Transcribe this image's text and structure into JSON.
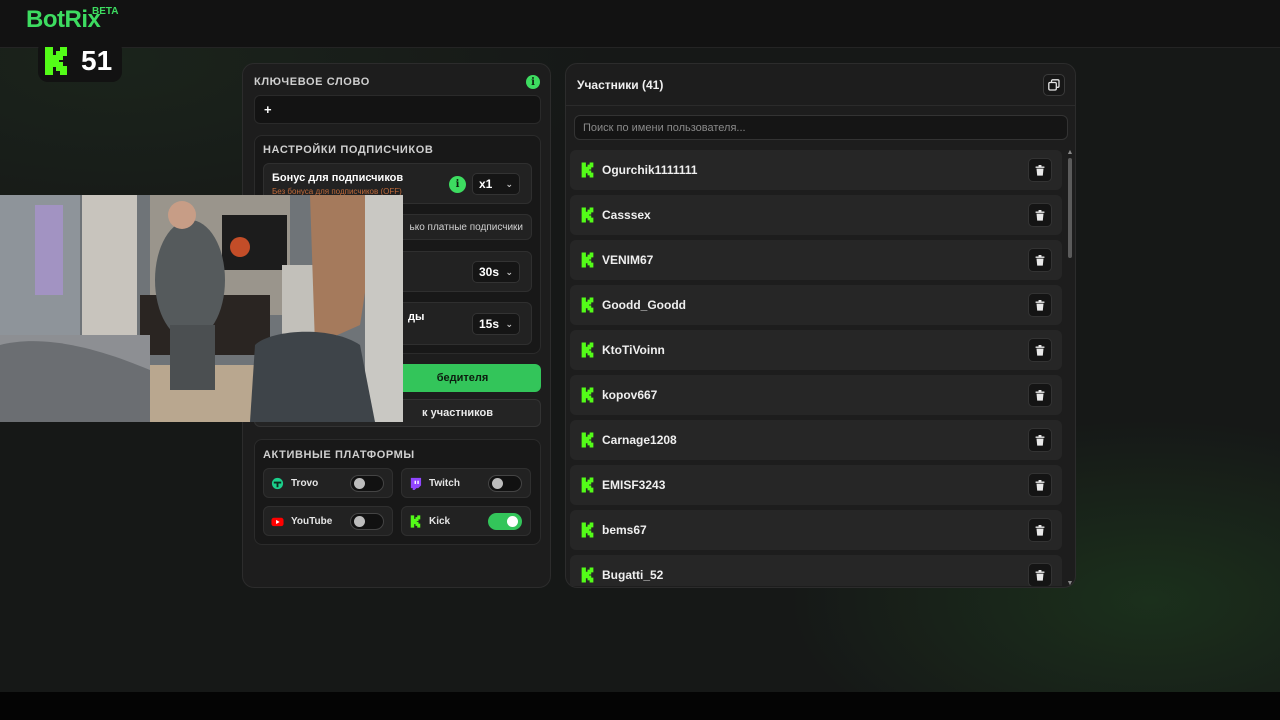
{
  "brand": {
    "name": "BotRix",
    "badge": "BETA"
  },
  "viewer_count": "51",
  "keyword": {
    "label": "КЛЮЧЕВОЕ СЛОВО",
    "value": "+"
  },
  "subscribers": {
    "title": "НАСТРОЙКИ ПОДПИСЧИКОВ",
    "bonus_label": "Бонус для подписчиков",
    "bonus_hint": "Без бонуса для подписчиков (OFF)",
    "bonus_value": "x1",
    "paid_only_text": "ько платные подписчики",
    "timer_value": "30s",
    "row4_partial": "ды",
    "timer2_value": "15s"
  },
  "buttons": {
    "pick_winner": "бедителя",
    "clear_list": "к участников"
  },
  "platforms": {
    "title": "АКТИВНЫЕ ПЛАТФОРМЫ",
    "items": [
      {
        "name": "Trovo",
        "enabled": false
      },
      {
        "name": "Twitch",
        "enabled": false
      },
      {
        "name": "YouTube",
        "enabled": false
      },
      {
        "name": "Kick",
        "enabled": true
      }
    ]
  },
  "participants": {
    "title": "Участники (41)",
    "search_placeholder": "Поиск по имени пользователя...",
    "users": [
      "Ogurchik1111111",
      "Casssex",
      "VENIM67",
      "Goodd_Goodd",
      "KtoTiVoinn",
      "kopov667",
      "Carnage1208",
      "EMISF3243",
      "bems67",
      "Bugatti_52"
    ]
  },
  "colors": {
    "accent": "#33c55a",
    "kick_green": "#53fc18",
    "panel": "#1d1d1d",
    "background": "#161817"
  },
  "icons": {
    "info": "i",
    "chevron": "⌄",
    "trash": "trash-icon",
    "copy": "copy-icon",
    "kick": "kick-logo-icon"
  }
}
